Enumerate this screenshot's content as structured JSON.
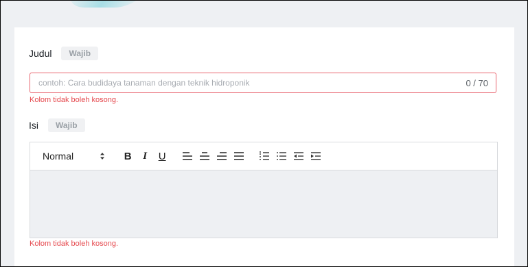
{
  "form": {
    "title_field": {
      "label": "Judul",
      "badge": "Wajib",
      "placeholder": "contoh: Cara budidaya tanaman dengan teknik hidroponik",
      "counter": "0 / 70",
      "error": "Kolom tidak boleh kosong."
    },
    "content_field": {
      "label": "Isi",
      "badge": "Wajib",
      "error": "Kolom tidak boleh kosong."
    },
    "toolbar": {
      "format_select": "Normal",
      "bold": "B",
      "italic": "I",
      "underline": "U",
      "icons": [
        "align-left-icon",
        "align-center-icon",
        "align-right-icon",
        "align-justify-icon",
        "ordered-list-icon",
        "bullet-list-icon",
        "outdent-icon",
        "indent-icon"
      ]
    }
  },
  "colors": {
    "error": "#e5484d",
    "error_border": "#e8636d",
    "badge_bg": "#f0f1f3",
    "page_bg": "#eef0f3"
  }
}
